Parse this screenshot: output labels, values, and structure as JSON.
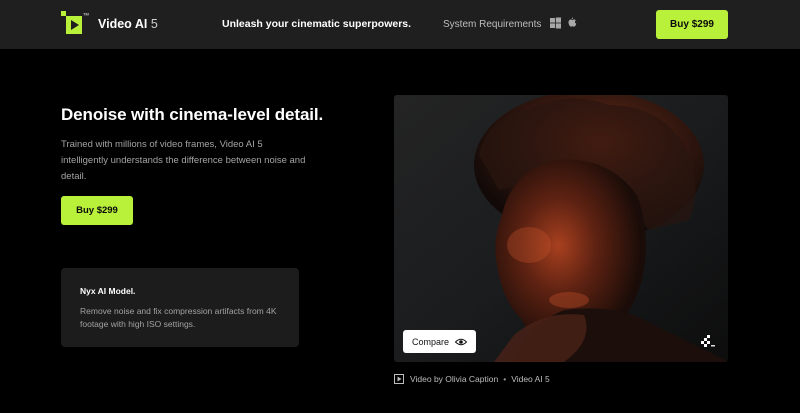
{
  "header": {
    "brand_name": "Video AI",
    "brand_version": "5",
    "tagline": "Unleash your cinematic superpowers.",
    "system_requirements": "System Requirements",
    "buy_label": "Buy  $299",
    "logo_tm": "TM",
    "icons": {
      "windows": "windows-icon",
      "apple": "apple-icon",
      "logo": "video-ai-logo"
    },
    "accent_color": "#b8f03a",
    "background_color": "#1f1f1f"
  },
  "hero": {
    "headline": "Denoise with cinema-level detail.",
    "description": "Trained with millions of video frames, Video AI 5 intelligently understands the difference between noise and detail.",
    "buy_label": "Buy  $299"
  },
  "model_card": {
    "title": "Nyx AI Model.",
    "text": "Remove noise and fix compression artifacts from 4K footage with high ISO settings."
  },
  "video": {
    "compare_label": "Compare",
    "icons": {
      "compare": "eye-icon",
      "watermark": "pixel-logo-icon"
    },
    "caption": {
      "credit": "Video by Olivia Caption",
      "separator": "•",
      "product": "Video AI 5",
      "icon": "play-icon"
    }
  },
  "colors": {
    "page_background": "#000000",
    "card_background": "#1c1c1c",
    "muted_text": "#a4a4a4"
  }
}
